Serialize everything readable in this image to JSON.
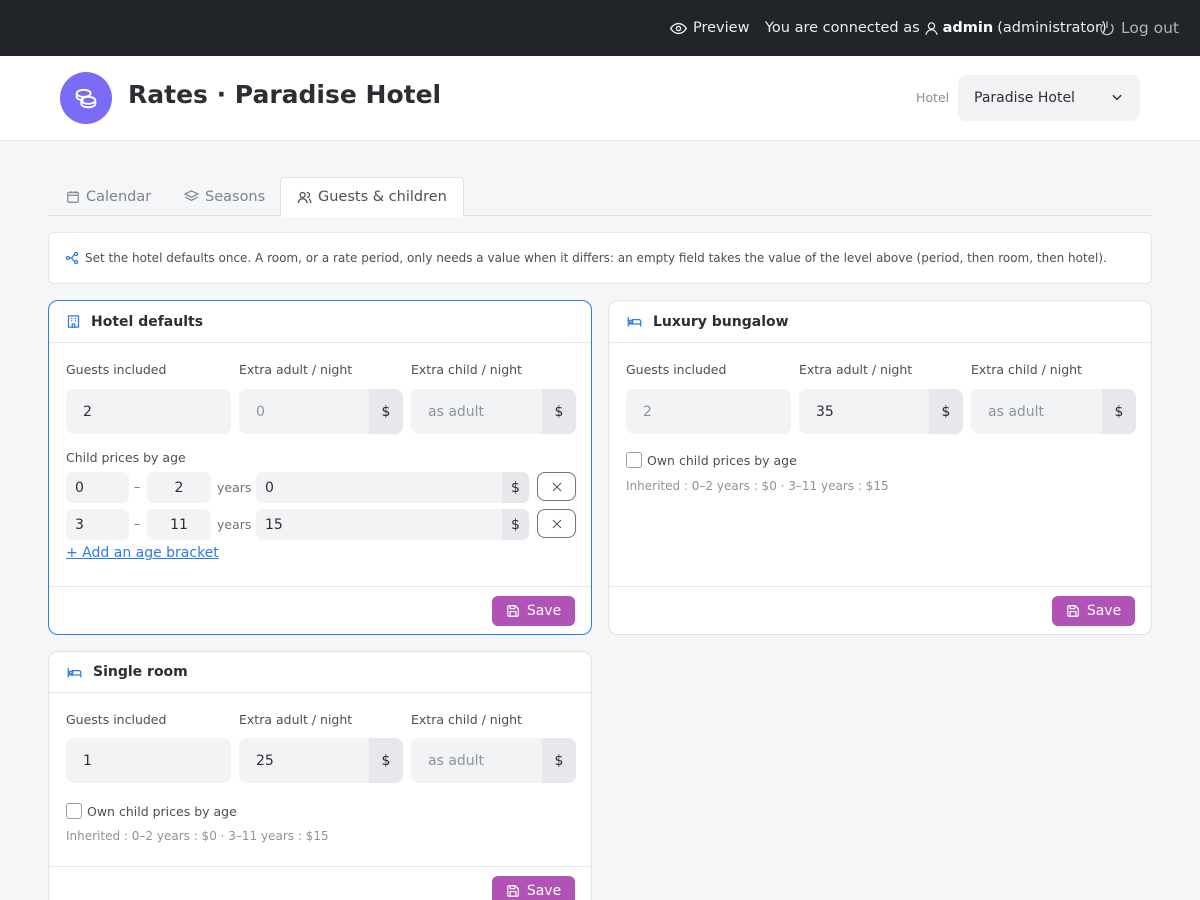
{
  "topbar": {
    "preview": "Preview",
    "connected_prefix": "You are connected as",
    "user": "admin",
    "role": "(administrator)",
    "logout": "Log out"
  },
  "header": {
    "title": "Rates · Paradise Hotel",
    "hotel_label": "Hotel",
    "hotel_value": "Paradise Hotel",
    "logo_color": "#7b6cf6"
  },
  "tabs": [
    {
      "label": "Calendar",
      "icon": "calendar-icon",
      "active": false
    },
    {
      "label": "Seasons",
      "icon": "layers-icon",
      "active": false
    },
    {
      "label": "Guests & children",
      "icon": "users-icon",
      "active": true
    }
  ],
  "info": "Set the hotel defaults once. A room, or a rate period, only needs a value when it differs: an empty field takes the value of the level above (period, then room, then hotel).",
  "labels": {
    "guests_included": "Guests included",
    "extra_adult": "Extra adult / night",
    "extra_child": "Extra child / night",
    "child_prices": "Child prices by age",
    "years": "years",
    "dash": "–",
    "currency": "$",
    "add_bracket": "+ Add an age bracket",
    "own_child_prices": "Own child prices by age",
    "save": "Save"
  },
  "hotel_defaults": {
    "title": "Hotel defaults",
    "guests_included": "2",
    "extra_adult_placeholder": "0",
    "extra_child_placeholder": "as adult",
    "brackets": [
      {
        "from": "0",
        "to": "2",
        "price": "0"
      },
      {
        "from": "3",
        "to": "11",
        "price": "15"
      }
    ]
  },
  "luxury_bungalow": {
    "title": "Luxury bungalow",
    "guests_included_placeholder": "2",
    "extra_adult": "35",
    "extra_child_placeholder": "as adult",
    "inherited": "Inherited : 0–2 years : $0 · 3–11 years : $15"
  },
  "single_room": {
    "title": "Single room",
    "guests_included": "1",
    "extra_adult": "25",
    "extra_child_placeholder": "as adult",
    "inherited": "Inherited : 0–2 years : $0 · 3–11 years : $15"
  },
  "colors": {
    "accent": "#b152b5",
    "link": "#2c7be5",
    "topbar": "#212529"
  }
}
